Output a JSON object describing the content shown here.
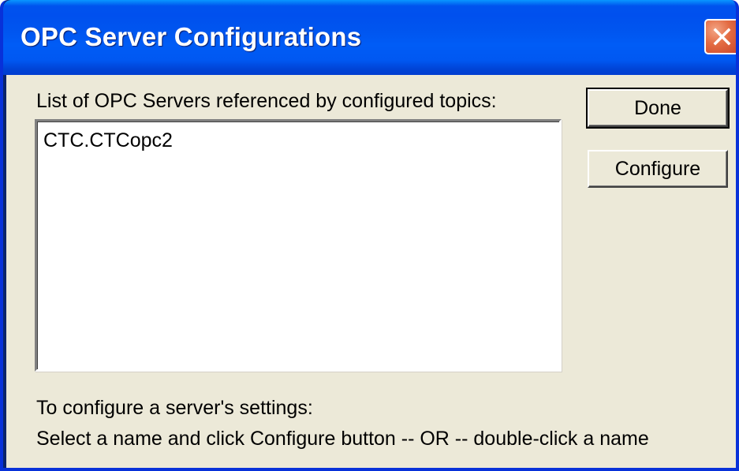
{
  "window": {
    "title": "OPC Server Configurations",
    "close_icon": "close-icon",
    "colors": {
      "titlebar": "#0054e3",
      "client": "#ece9d8",
      "close_button": "#e36b42"
    }
  },
  "list": {
    "caption": "List of OPC Servers referenced by configured topics:",
    "items": [
      "CTC.CTCopc2"
    ]
  },
  "buttons": {
    "done_label": "Done",
    "configure_label": "Configure"
  },
  "help": {
    "line1": "To configure a server's settings:",
    "line2": "Select a name and click Configure button -- OR --  double-click a name"
  }
}
